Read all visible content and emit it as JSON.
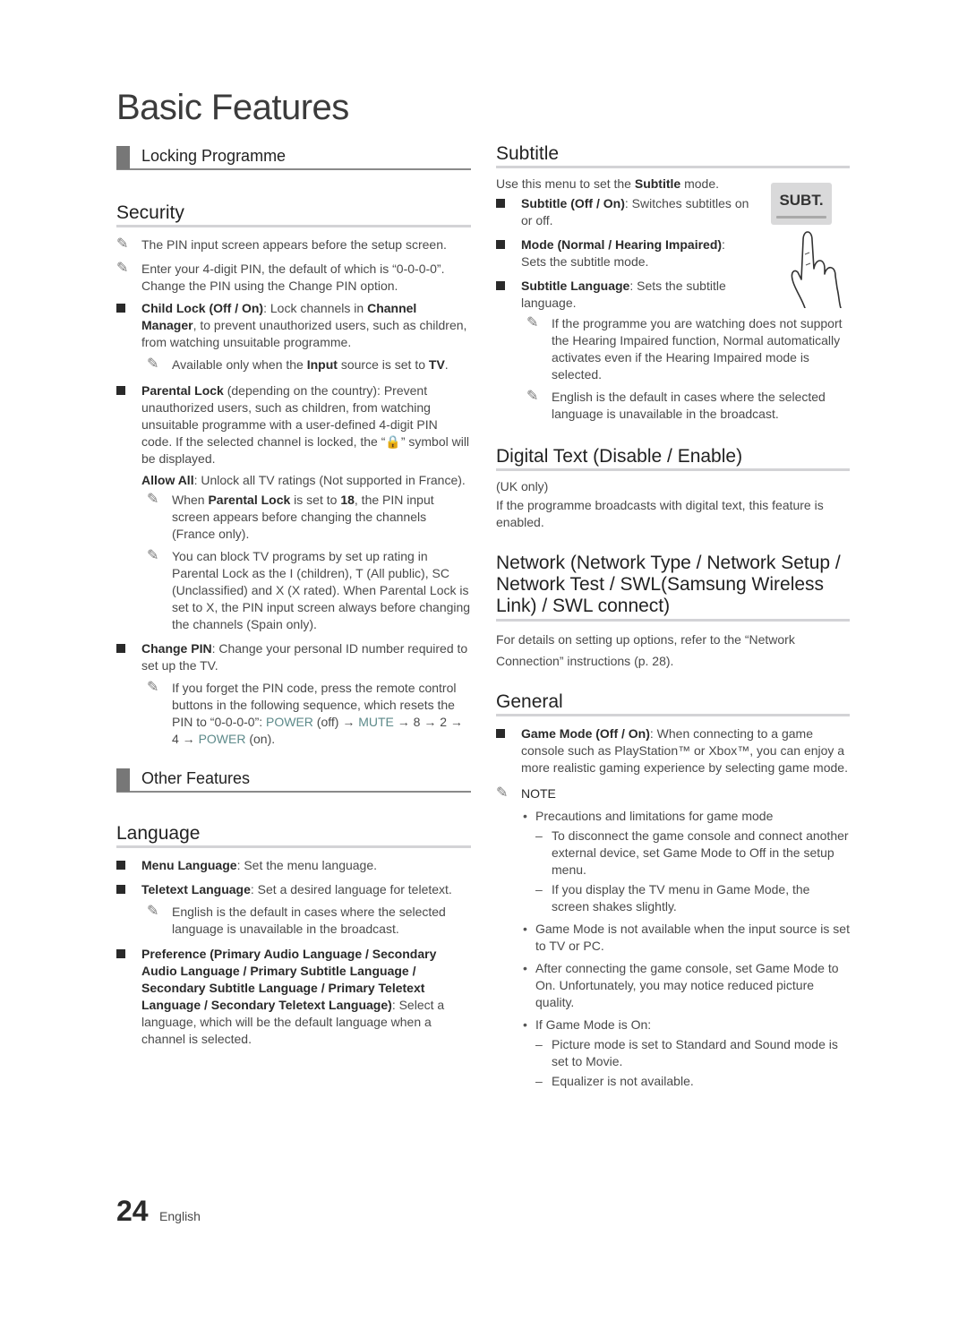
{
  "page_title": "Basic Features",
  "left": {
    "locking_programme": "Locking Programme",
    "security": {
      "heading": "Security",
      "note1": "The PIN input screen appears before the setup screen.",
      "note2": "Enter your 4-digit PIN, the default of which is “0-0-0-0”. Change the PIN using the Change PIN option.",
      "child_lock_label": "Child Lock (Off / On)",
      "child_lock_text_a": ": Lock channels in ",
      "child_lock_channel_manager": "Channel Manager",
      "child_lock_text_b": ", to prevent unauthorized users, such as children, from watching unsuitable programme.",
      "child_lock_note_a": "Available only when the ",
      "child_lock_note_input": "Input",
      "child_lock_note_b": " source is set to ",
      "child_lock_note_tv": "TV",
      "parental_lock_label": "Parental Lock",
      "parental_lock_text": " (depending on the country): Prevent unauthorized users, such as children, from watching unsuitable programme with a user-defined 4-digit PIN code. If the selected channel is locked, the “🔒” symbol will be displayed.",
      "allow_all_label": "Allow All",
      "allow_all_text": ": Unlock all TV ratings (Not supported in France).",
      "note_france_a": "When ",
      "note_france_pl": "Parental Lock",
      "note_france_b": " is set to ",
      "note_france_18": "18",
      "note_france_c": ", the PIN input screen appears before changing the channels (France only).",
      "note_spain": "You can block TV programs by set up rating in Parental Lock as the I (children), T (All public), SC (Unclassified) and X (X rated). When Parental Lock is set to X, the PIN input screen always before changing the channels (Spain only).",
      "change_pin_label": "Change PIN",
      "change_pin_text": ": Change your personal ID number required to set up the TV.",
      "change_pin_note_a": "If you forget the PIN code, press the remote control buttons in the following sequence, which resets the PIN to “0-0-0-0”: ",
      "power": "POWER",
      "off": " (off) →",
      "mute": "MUTE",
      "sequence": " → 8 → 2 → 4 → ",
      "on": " (on)."
    },
    "other_features": "Other Features",
    "language": {
      "heading": "Language",
      "menu_label": "Menu Language",
      "menu_text": ": Set the menu language.",
      "teletext_label": "Teletext Language",
      "teletext_text": ": Set a desired language for teletext.",
      "teletext_note": "English is the default in cases where the selected language is unavailable in the broadcast.",
      "preference_label": "Preference (Primary Audio Language / Secondary Audio Language / Primary Subtitle Language / Secondary Subtitle Language / Primary Teletext Language / Secondary Teletext Language)",
      "preference_text": ": Select a language, which will be the default language when a channel is selected."
    }
  },
  "right": {
    "subtitle": {
      "heading": "Subtitle",
      "intro_a": "Use this menu to set the ",
      "intro_b": "Subtitle",
      "intro_c": " mode.",
      "button_label": "SUBT.",
      "item1_label": "Subtitle (Off / On)",
      "item1_text": ": Switches subtitles on or off.",
      "item2_label": "Mode (Normal / Hearing Impaired)",
      "item2_text": ": Sets the subtitle mode.",
      "item3_label": "Subtitle Language",
      "item3_text": ": Sets the subtitle language.",
      "note1": "If the programme you are watching does not support the Hearing Impaired function, Normal automatically activates even if the Hearing Impaired mode is selected.",
      "note2": "English is the default in cases where the selected language is unavailable in the broadcast."
    },
    "digital_text": {
      "heading": "Digital Text (Disable / Enable)",
      "uk_only": "(UK only)",
      "body": "If the programme broadcasts with digital text, this feature is enabled."
    },
    "network": {
      "heading": "Network (Network Type / Network Setup / Network Test / SWL(Samsung Wireless Link) / SWL connect)",
      "body": "For details on setting up options, refer to the “Network Connection” instructions (p. 28)."
    },
    "general": {
      "heading": "General",
      "game_mode_label": "Game Mode (Off / On)",
      "game_mode_text": ": When connecting to a game console such as PlayStation™ or Xbox™, you can enjoy a more realistic gaming experience by selecting game mode.",
      "note_label": "NOTE",
      "bullet1": "Precautions and limitations for game mode",
      "dash1": "To disconnect the game console and connect another external device, set Game Mode to Off in the setup menu.",
      "dash2": "If you display the TV menu in Game Mode, the screen shakes slightly.",
      "bullet2": "Game Mode is not available when the input source is set to TV or PC.",
      "bullet3": "After connecting the game console, set Game Mode to On. Unfortunately, you may notice reduced picture quality.",
      "bullet4": "If Game Mode is On:",
      "dash3": "Picture mode is set to Standard and Sound mode is set to Movie.",
      "dash4": "Equalizer is not available."
    }
  },
  "footer": {
    "page_number": "24",
    "language": "English"
  }
}
